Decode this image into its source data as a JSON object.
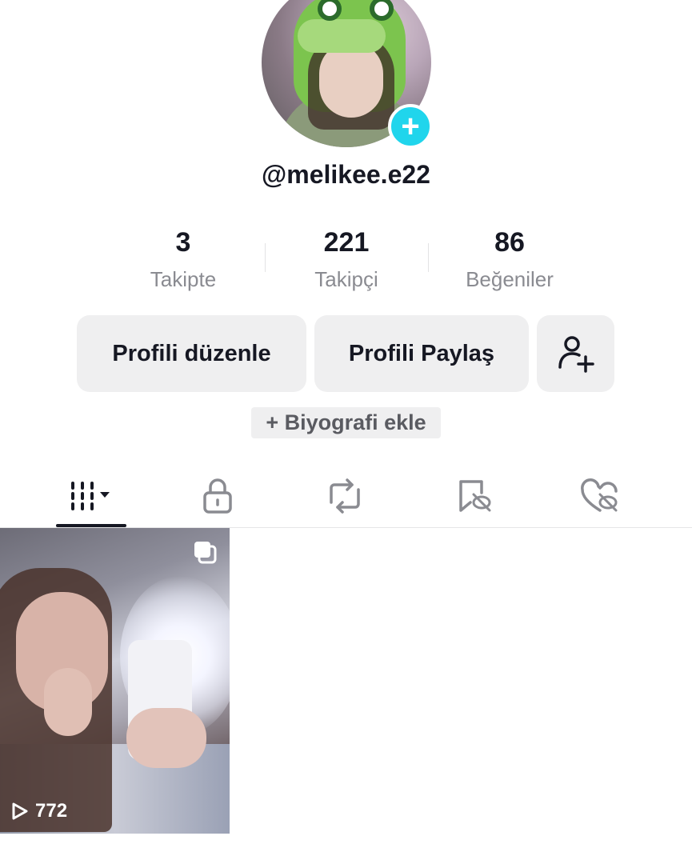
{
  "profile": {
    "username": "@melikee.e22",
    "add_badge": "+"
  },
  "stats": [
    {
      "value": "3",
      "label": "Takipte"
    },
    {
      "value": "221",
      "label": "Takipçi"
    },
    {
      "value": "86",
      "label": "Beğeniler"
    }
  ],
  "buttons": {
    "edit_label": "Profili düzenle",
    "share_label": "Profili Paylaş",
    "add_friend_icon": "person-plus-icon"
  },
  "bio": {
    "add_label": "+ Biyografi ekle"
  },
  "tabs": [
    {
      "icon": "grid-icon",
      "active": true
    },
    {
      "icon": "lock-icon",
      "active": false
    },
    {
      "icon": "repost-icon",
      "active": false
    },
    {
      "icon": "favorites-hidden-icon",
      "active": false
    },
    {
      "icon": "liked-hidden-icon",
      "active": false
    }
  ],
  "videos": [
    {
      "views": "772",
      "multi_image": true
    }
  ],
  "colors": {
    "accent": "#20d5ec",
    "text": "#161823",
    "muted": "#8a8b91",
    "button_bg": "#efeff0"
  }
}
